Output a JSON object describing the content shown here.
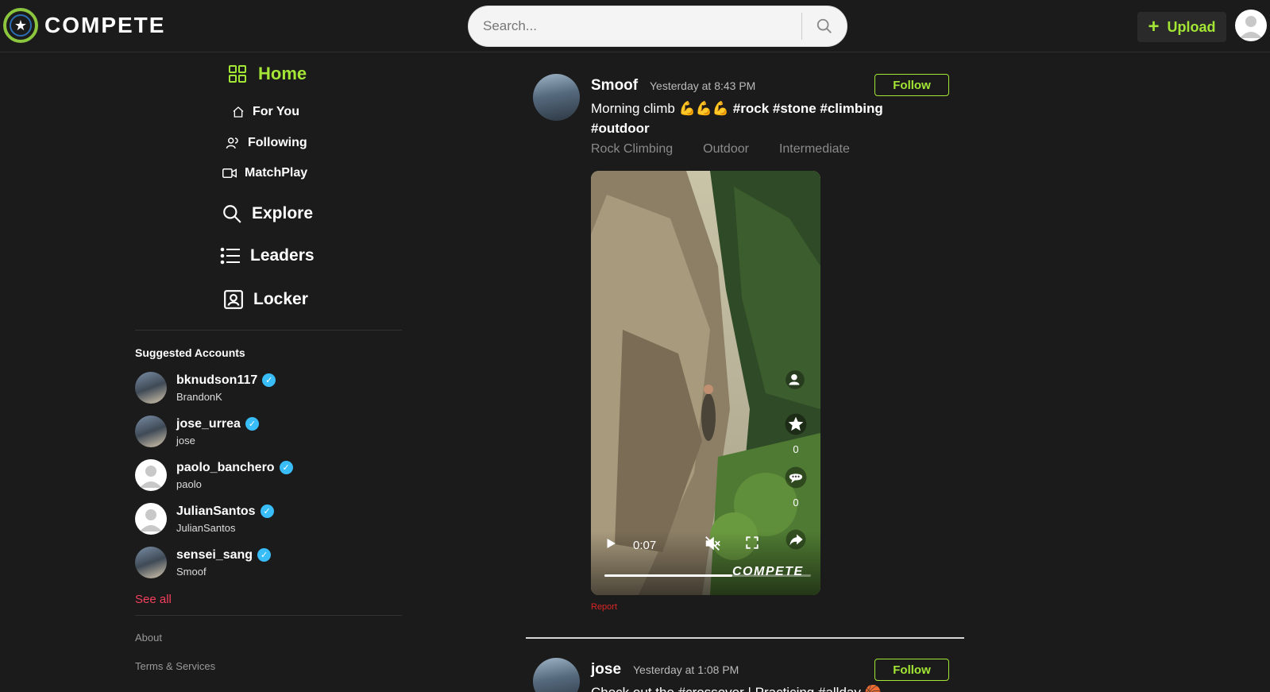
{
  "app": {
    "logo_text": "COMPETE"
  },
  "search": {
    "placeholder": "Search..."
  },
  "header": {
    "upload_label": "Upload"
  },
  "nav": {
    "home": "Home",
    "for_you": "For You",
    "following": "Following",
    "matchplay": "MatchPlay",
    "explore": "Explore",
    "leaders": "Leaders",
    "locker": "Locker"
  },
  "suggested": {
    "title": "Suggested Accounts",
    "accounts": [
      {
        "name": "bknudson117",
        "handle": "BrandonK",
        "verified": true,
        "avatar": "photo"
      },
      {
        "name": "jose_urrea",
        "handle": "jose",
        "verified": true,
        "avatar": "photo"
      },
      {
        "name": "paolo_banchero",
        "handle": "paolo",
        "verified": true,
        "avatar": "blank"
      },
      {
        "name": "JulianSantos",
        "handle": "JulianSantos",
        "verified": true,
        "avatar": "blank"
      },
      {
        "name": "sensei_sang",
        "handle": "Smoof",
        "verified": true,
        "avatar": "photo"
      }
    ],
    "see_all": "See all"
  },
  "footer": {
    "about": "About",
    "terms": "Terms & Services"
  },
  "posts": [
    {
      "user": "Smoof",
      "time": "Yesterday at 8:43 PM",
      "follow_label": "Follow",
      "caption_text": "Morning climb",
      "caption_emoji": "💪💪💪",
      "hashtags_line1": "#rock #stone #climbing",
      "hashtags_line2": "#outdoor",
      "tags": [
        "Rock Climbing",
        "Outdoor",
        "Intermediate"
      ],
      "video": {
        "time": "0:07",
        "progress": 0.62,
        "watermark": "COMPETE",
        "likes": "0",
        "comments": "0"
      },
      "report_label": "Report"
    },
    {
      "user": "jose",
      "time": "Yesterday at 1:08 PM",
      "follow_label": "Follow",
      "caption_partial": "Check out the #crossover | Practicing #allday 🏀"
    }
  ],
  "colors": {
    "accent": "#a3e635",
    "background": "#1b1b1b",
    "link_red": "#f43f5e",
    "verified": "#38bdf8"
  }
}
